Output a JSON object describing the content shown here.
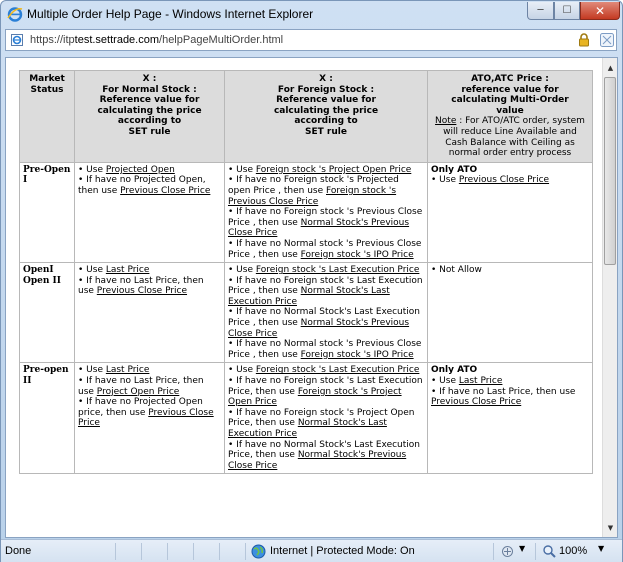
{
  "window": {
    "title": "Multiple Order Help Page - Windows Internet Explorer",
    "minimize": "─",
    "maximize": "☐",
    "close": "✕"
  },
  "address": {
    "prefix": "https://itp",
    "host": "test.settrade.com",
    "path": "/helpPageMultiOrder.html"
  },
  "table": {
    "headers": {
      "status": [
        "Market",
        "Status"
      ],
      "normal": [
        "X :",
        "For Normal Stock :",
        "Reference value for",
        "calculating the price",
        "according to",
        "SET rule"
      ],
      "foreign": [
        "X :",
        "For Foreign Stock :",
        "Reference value for",
        "calculating the price",
        "according to",
        "SET rule"
      ],
      "ato": [
        "ATO,ATC Price :",
        "reference value for",
        "calculating Multi-Order",
        "value"
      ],
      "ato_note_label": "Note",
      "ato_note": " : For ATO/ATC order, system will reduce Line Available and Cash Balance with Ceiling as normal order entry process"
    },
    "rows": [
      {
        "status": [
          "Pre-Open",
          "I"
        ],
        "normal": [
          {
            "text": "•  Use ",
            "link": "Projected Open",
            "tail": ""
          },
          {
            "text": "•  If have no Projected Open, then use ",
            "link": "Previous Close Price",
            "tail": ""
          }
        ],
        "foreign": [
          {
            "text": "•  Use ",
            "link": "Foreign stock 's Project Open Price",
            "tail": ""
          },
          {
            "text": "•  If have no Foreign stock 's Projected open Price , then use ",
            "link": "Foreign stock 's Previous Close Price",
            "tail": ""
          },
          {
            "text": "•  If have no Foreign stock 's Previous Close Price , then use ",
            "link": "Normal Stock's Previous Close Price",
            "tail": ""
          },
          {
            "text": "•  If have no Normal stock 's Previous Close Price , then use ",
            "link": "Foreign stock 's IPO Price",
            "tail": ""
          }
        ],
        "ato_head": "Only ATO",
        "ato": [
          {
            "text": "•  Use ",
            "link": "Previous Close Price",
            "tail": ""
          }
        ]
      },
      {
        "status": [
          "OpenI",
          "Open II"
        ],
        "normal": [
          {
            "text": "•  Use ",
            "link": "Last Price",
            "tail": ""
          },
          {
            "text": "•  If have no Last Price, then use ",
            "link": "Previous Close Price",
            "tail": ""
          }
        ],
        "foreign": [
          {
            "text": "•  Use ",
            "link": "Foreign stock 's Last Execution Price",
            "tail": ""
          },
          {
            "text": "•  If have no Foreign stock 's Last Execution Price , then use ",
            "link": "Normal Stock's Last Execution Price",
            "tail": ""
          },
          {
            "text": "•  If have no Normal Stock's Last Execution Price , then use ",
            "link": "Normal Stock's Previous Close Price",
            "tail": ""
          },
          {
            "text": "•  If have no Normal stock 's Previous Close Price , then use ",
            "link": "Foreign stock 's IPO Price",
            "tail": ""
          }
        ],
        "ato_head": "",
        "ato": [
          {
            "text": "•  Not Allow",
            "link": "",
            "tail": ""
          }
        ]
      },
      {
        "status": [
          "Pre-open",
          "II"
        ],
        "normal": [
          {
            "text": "•  Use ",
            "link": "Last Price",
            "tail": ""
          },
          {
            "text": "•  If have no Last Price, then use ",
            "link": "Project Open Price",
            "tail": ""
          },
          {
            "text": "•  If have no Projected Open price, then use ",
            "link": "Previous Close Price",
            "tail": ""
          }
        ],
        "foreign": [
          {
            "text": "•  Use ",
            "link": "Foreign stock 's Last Execution Price",
            "tail": ""
          },
          {
            "text": "•  If have no Foreign stock 's Last Execution Price, then use ",
            "link": "Foreign stock 's Project Open Price",
            "tail": ""
          },
          {
            "text": "•  If have no Foreign stock 's Project Open Price, then use ",
            "link": "Normal Stock's Last Execution Price",
            "tail": ""
          },
          {
            "text": "•  If have no Normal Stock's Last Execution Price, then use ",
            "link": "Normal Stock's Previous Close Price",
            "tail": ""
          }
        ],
        "ato_head": "Only ATO",
        "ato": [
          {
            "text": "•  Use ",
            "link": "Last Price",
            "tail": ""
          },
          {
            "text": "•  If have no Last Price, then use ",
            "link": "Previous Close Price",
            "tail": ""
          }
        ]
      }
    ]
  },
  "statusbar": {
    "done": "Done",
    "zone": "Internet | Protected Mode: On",
    "zoom": "100%",
    "dropdown": "▼"
  }
}
